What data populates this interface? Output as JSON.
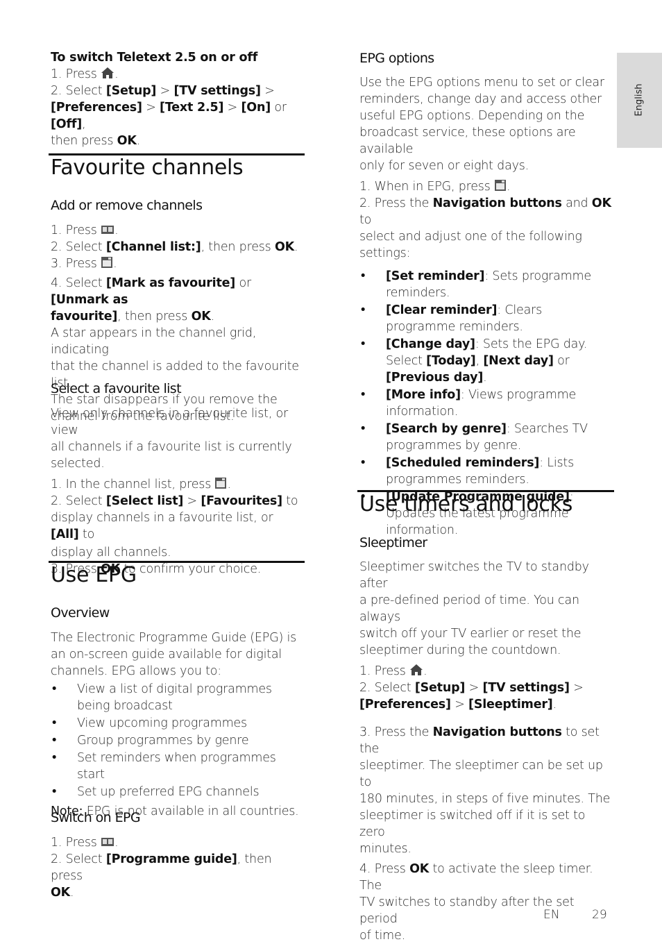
{
  "language_tab": "English",
  "footer": {
    "lang": "EN",
    "page": "29"
  },
  "left": {
    "teletext": {
      "heading": "To switch Teletext 2.5 on or off",
      "step1_prefix": "1. Press ",
      "step2_prefix": "2. Select ",
      "setup": "[Setup]",
      "gt": " > ",
      "tv_settings": "[TV settings]",
      "preferences": "[Preferences]",
      "text25": "[Text 2.5]",
      "on": "[On]",
      "or": " or ",
      "off": "[Off]",
      "then_press": ",",
      "then_press2": "then press ",
      "ok": "OK",
      "dot": "."
    },
    "favourite": {
      "title": "Favourite channels",
      "add_remove_heading": "Add or remove channels",
      "s1": "1. Press ",
      "s2_prefix": "2. Select ",
      "channel_list": "[Channel list:]",
      "s2_suffix": ", then press ",
      "ok": "OK",
      "s3": "3. Press ",
      "s4_prefix": "4. Select ",
      "mark": "[Mark as favourite]",
      "or": " or ",
      "unmark_a": "[Unmark as",
      "unmark_b": "favourite]",
      "s4_suffix": ", then press ",
      "star_para": [
        "A star appears in the channel grid, indicating",
        "that the channel is added to the favourite list.",
        "The star disappears if you remove the",
        "channel from the favourite list."
      ],
      "select_heading": "Select a favourite list",
      "select_para": [
        "View only channels in a favourite list, or view",
        "all channels if a favourite list is currently",
        "selected."
      ],
      "f1": "1. In the channel list, press ",
      "f2_prefix": "2. Select ",
      "select_list": "[Select list]",
      "gt": " > ",
      "favourites": "[Favourites]",
      "f2_to": " to",
      "f2_line2a": "display channels in a favourite list, or ",
      "all": "[All]",
      "f2_line2b": " to",
      "f2_line3": "display all channels.",
      "f3_prefix": "3. Press ",
      "f3_suffix": " to confirm your choice."
    },
    "epg": {
      "title": "Use EPG",
      "overview_heading": "Overview",
      "overview_para": [
        "The Electronic Programme Guide (EPG) is",
        "an on-screen guide available for digital",
        "channels. EPG allows you to:"
      ],
      "bullets": [
        "View a list of digital programmes being broadcast",
        "View upcoming programmes",
        "Group programmes by genre",
        "Set reminders when programmes start",
        "Set up preferred EPG channels"
      ],
      "note_label": "Note:",
      "note_text": " EPG is not available in all countries.",
      "switch_heading": "Switch on EPG",
      "e1": "1. Press ",
      "e2_prefix": "2. Select ",
      "programme_guide": "[Programme guide]",
      "e2_suffix": ", then press",
      "ok": "OK"
    }
  },
  "right": {
    "epg_options": {
      "heading": "EPG options",
      "para": [
        "Use the EPG options menu to set or clear",
        "reminders, change day and access other",
        "useful EPG options. Depending on the",
        "broadcast service, these options are available",
        "only for seven or eight days."
      ],
      "o1": "1. When in EPG, press ",
      "o2_prefix": "2. Press the ",
      "nav": "Navigation buttons",
      "and": " and ",
      "ok": "OK",
      "o2_to": " to",
      "o2_l2": "select and adjust one of the following",
      "o2_l3": "settings:",
      "bullets": [
        {
          "label": "[Set reminder]",
          "text": ": Sets programme reminders."
        },
        {
          "label": "[Clear reminder]",
          "text": ": Clears programme reminders."
        },
        {
          "label": "[Change day]",
          "text": ": Sets the EPG day. Select "
        },
        {
          "label": "[More info]",
          "text": ": Views programme information."
        },
        {
          "label": "[Search by genre]",
          "text": ": Searches TV programmes by genre."
        },
        {
          "label": "[Scheduled reminders]",
          "text": ": Lists programmes reminders."
        },
        {
          "label": "[Update Programme guide]",
          "text": ": Updates the latest programme information."
        }
      ],
      "change_day_opts": {
        "today": "[Today]",
        "comma": ", ",
        "next": "[Next day]",
        "or": " or ",
        "prev": "[Previous day]",
        "dot": "."
      }
    },
    "timers": {
      "title": "Use timers and locks",
      "sleep_heading": "Sleeptimer",
      "para": [
        "Sleeptimer switches the TV to standby after",
        "a pre-defined period of time. You can always",
        "switch off your TV earlier or reset the",
        "sleeptimer during the countdown."
      ],
      "t1": "1. Press ",
      "t2_prefix": "2. Select ",
      "setup": "[Setup]",
      "gt": " > ",
      "tv_settings": "[TV settings]",
      "preferences": "[Preferences]",
      "sleeptimer": "[Sleeptimer]",
      "t3_prefix": "3. Press the ",
      "nav": "Navigation buttons",
      "t3_suffix": " to set the",
      "t3_lines": [
        "sleeptimer. The sleeptimer can be set up to",
        "180 minutes, in steps of five minutes. The",
        "sleeptimer is switched off if it is set to zero",
        "minutes."
      ],
      "t4_prefix": "4. Press ",
      "ok": "OK",
      "t4_suffix": " to activate the sleep timer. The",
      "t4_lines": [
        "TV switches to standby after the set period",
        "of time."
      ]
    }
  }
}
